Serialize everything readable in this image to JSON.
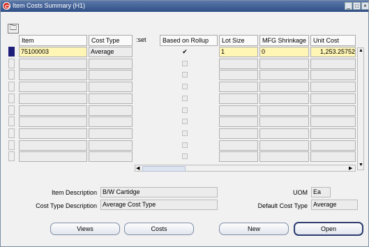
{
  "window": {
    "title": "Item Costs Summary (H1)"
  },
  "toolbar": {
    "icon": "folder-icon"
  },
  "columns": {
    "item": "Item",
    "cost_type": "Cost Type",
    "set": ":set",
    "rollup": "Based on Rollup",
    "lot": "Lot Size",
    "shrink": "MFG Shrinkage",
    "unit": "Unit Cost"
  },
  "rows": [
    {
      "item": "75100003",
      "cost_type": "Average",
      "rollup": true,
      "lot": "1",
      "shrink": "0",
      "unit": "1,253.25752"
    }
  ],
  "details": {
    "item_desc_label": "Item Description",
    "item_desc": "B/W Cartidge",
    "cost_type_desc_label": "Cost Type Description",
    "cost_type_desc": "Average Cost Type",
    "uom_label": "UOM",
    "uom": "Ea",
    "default_cost_label": "Default Cost Type",
    "default_cost": "Average"
  },
  "buttons": {
    "views": "Views",
    "costs": "Costs",
    "new": "New",
    "open": "Open"
  }
}
